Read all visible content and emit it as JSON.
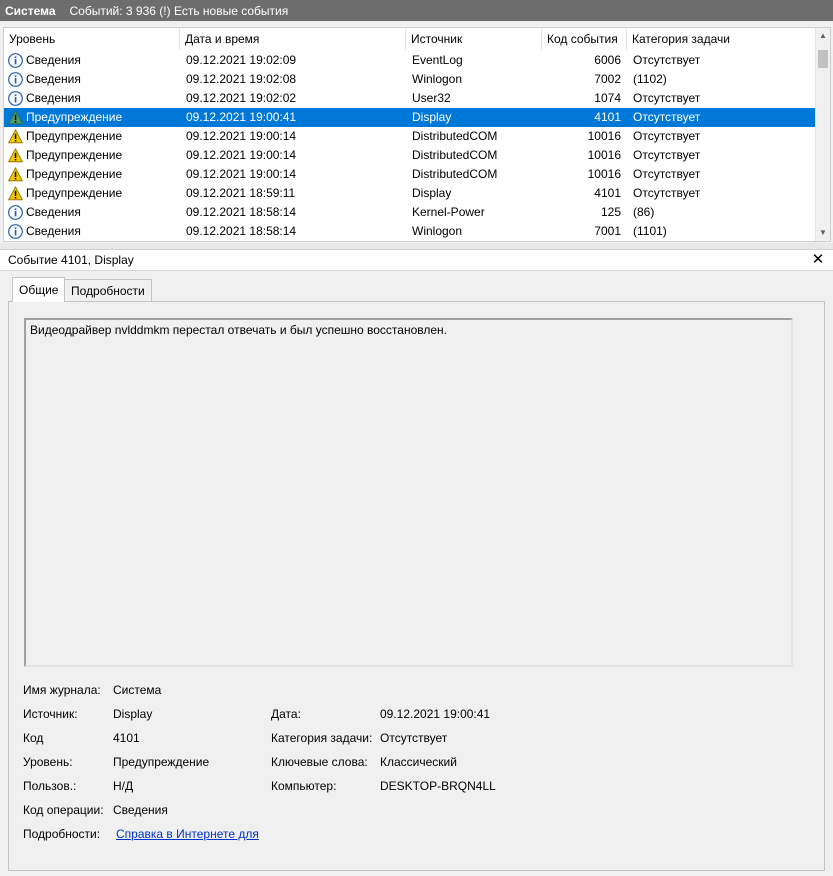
{
  "title": {
    "log_name": "Система",
    "status": "Событий: 3 936 (!) Есть новые события"
  },
  "columns": [
    "Уровень",
    "Дата и время",
    "Источник",
    "Код события",
    "Категория задачи"
  ],
  "rows": [
    {
      "type": "info",
      "level": "Сведения",
      "datetime": "09.12.2021 19:02:09",
      "source": "EventLog",
      "code": "6006",
      "category": "Отсутствует"
    },
    {
      "type": "info",
      "level": "Сведения",
      "datetime": "09.12.2021 19:02:08",
      "source": "Winlogon",
      "code": "7002",
      "category": "(1102)"
    },
    {
      "type": "info",
      "level": "Сведения",
      "datetime": "09.12.2021 19:02:02",
      "source": "User32",
      "code": "1074",
      "category": "Отсутствует"
    },
    {
      "type": "warn",
      "level": "Предупреждение",
      "datetime": "09.12.2021 19:00:41",
      "source": "Display",
      "code": "4101",
      "category": "Отсутствует",
      "selected": true
    },
    {
      "type": "warn",
      "level": "Предупреждение",
      "datetime": "09.12.2021 19:00:14",
      "source": "DistributedCOM",
      "code": "10016",
      "category": "Отсутствует"
    },
    {
      "type": "warn",
      "level": "Предупреждение",
      "datetime": "09.12.2021 19:00:14",
      "source": "DistributedCOM",
      "code": "10016",
      "category": "Отсутствует"
    },
    {
      "type": "warn",
      "level": "Предупреждение",
      "datetime": "09.12.2021 19:00:14",
      "source": "DistributedCOM",
      "code": "10016",
      "category": "Отсутствует"
    },
    {
      "type": "warn",
      "level": "Предупреждение",
      "datetime": "09.12.2021 18:59:11",
      "source": "Display",
      "code": "4101",
      "category": "Отсутствует"
    },
    {
      "type": "info",
      "level": "Сведения",
      "datetime": "09.12.2021 18:58:14",
      "source": "Kernel-Power",
      "code": "125",
      "category": "(86)"
    },
    {
      "type": "info",
      "level": "Сведения",
      "datetime": "09.12.2021 18:58:14",
      "source": "Winlogon",
      "code": "7001",
      "category": "(1101)"
    }
  ],
  "detail": {
    "title": "Событие 4101, Display",
    "tabs": [
      "Общие",
      "Подробности"
    ],
    "message": "Видеодрайвер nvlddmkm перестал отвечать и был успешно восстановлен.",
    "props": {
      "log_label": "Имя журнала:",
      "log_value": "Система",
      "source_label": "Источник:",
      "source_value": "Display",
      "date_label": "Дата:",
      "date_value": "09.12.2021 19:00:41",
      "code_label": "Код",
      "code_value": "4101",
      "taskcat_label": "Категория задачи:",
      "taskcat_value": "Отсутствует",
      "level_label": "Уровень:",
      "level_value": "Предупреждение",
      "keywords_label": "Ключевые слова:",
      "keywords_value": "Классический",
      "user_label": "Пользов.:",
      "user_value": "Н/Д",
      "computer_label": "Компьютер:",
      "computer_value": "DESKTOP-BRQN4LL",
      "opcode_label": "Код операции:",
      "opcode_value": "Сведения",
      "more_label": "Подробности:",
      "more_link": "Справка в Интернете для"
    }
  },
  "colors": {
    "selection": "#0078d7",
    "titlebar": "#6d6d6d",
    "link": "#0033cc",
    "info_icon": "#1e5fb0",
    "warn_icon": "#f2c700"
  },
  "icons": {
    "info": "info-icon",
    "warn": "warning-icon",
    "close": "close-icon"
  }
}
